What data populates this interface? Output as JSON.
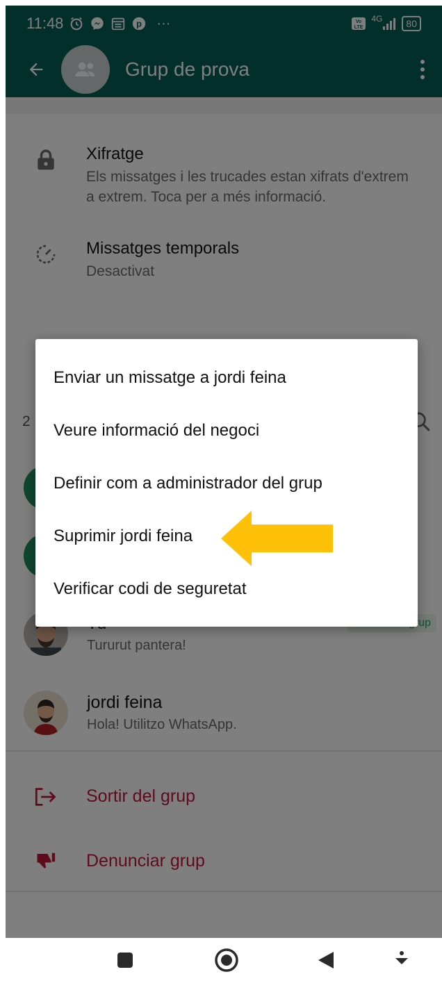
{
  "status_bar": {
    "time": "11:48",
    "network": "4G",
    "battery": "80",
    "more": "···"
  },
  "app_bar": {
    "title": "Grup de prova"
  },
  "settings": {
    "encryption": {
      "title": "Xifratge",
      "description": "Els missatges i les trucades estan xifrats d'extrem a extrem. Toca per a més informació."
    },
    "temporal": {
      "title": "Missatges temporals",
      "value": "Desactivat"
    }
  },
  "participants": {
    "count_partial": "2",
    "members": [
      {
        "name": "Tu",
        "status": "Tururut pantera!",
        "badge": "Admin. del grup"
      },
      {
        "name": "jordi feina",
        "status": "Hola! Utilitzo WhatsApp."
      }
    ]
  },
  "actions": {
    "leave": "Sortir del grup",
    "report": "Denunciar grup"
  },
  "context_menu": {
    "items": [
      "Enviar un missatge a jordi feina",
      "Veure informació del negoci",
      "Definir com a administrador del grup",
      "Suprimir jordi feina",
      "Verificar codi de seguretat"
    ]
  },
  "colors": {
    "header_green": "#075e54",
    "danger_red": "#c0163a",
    "arrow_yellow": "#ffc107",
    "admin_green": "#1ea86a"
  },
  "icons": [
    "alarm-icon",
    "messenger-icon",
    "calendar-icon",
    "pinterest-icon",
    "volte-icon",
    "signal-icon",
    "battery-icon",
    "back-arrow-icon",
    "group-avatar-icon",
    "overflow-menu-icon",
    "lock-icon",
    "timer-icon",
    "search-icon",
    "exit-icon",
    "thumbs-down-icon",
    "square-icon",
    "circle-icon",
    "triangle-back-icon",
    "download-icon"
  ]
}
